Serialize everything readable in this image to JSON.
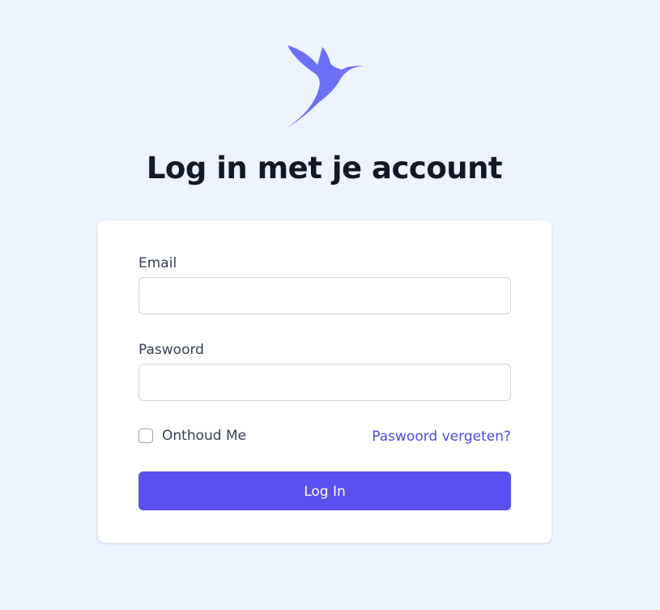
{
  "logo": {
    "icon": "hummingbird-icon",
    "color": "#6a70f7"
  },
  "page": {
    "title": "Log in met je account"
  },
  "form": {
    "email_label": "Email",
    "email_value": "",
    "password_label": "Paswoord",
    "password_value": "",
    "remember_label": "Onthoud Me",
    "forgot_link": "Paswoord vergeten?",
    "submit_label": "Log In"
  },
  "colors": {
    "background": "#ebf4ff",
    "accent": "#5b4ff0",
    "link": "#4f46e5"
  }
}
